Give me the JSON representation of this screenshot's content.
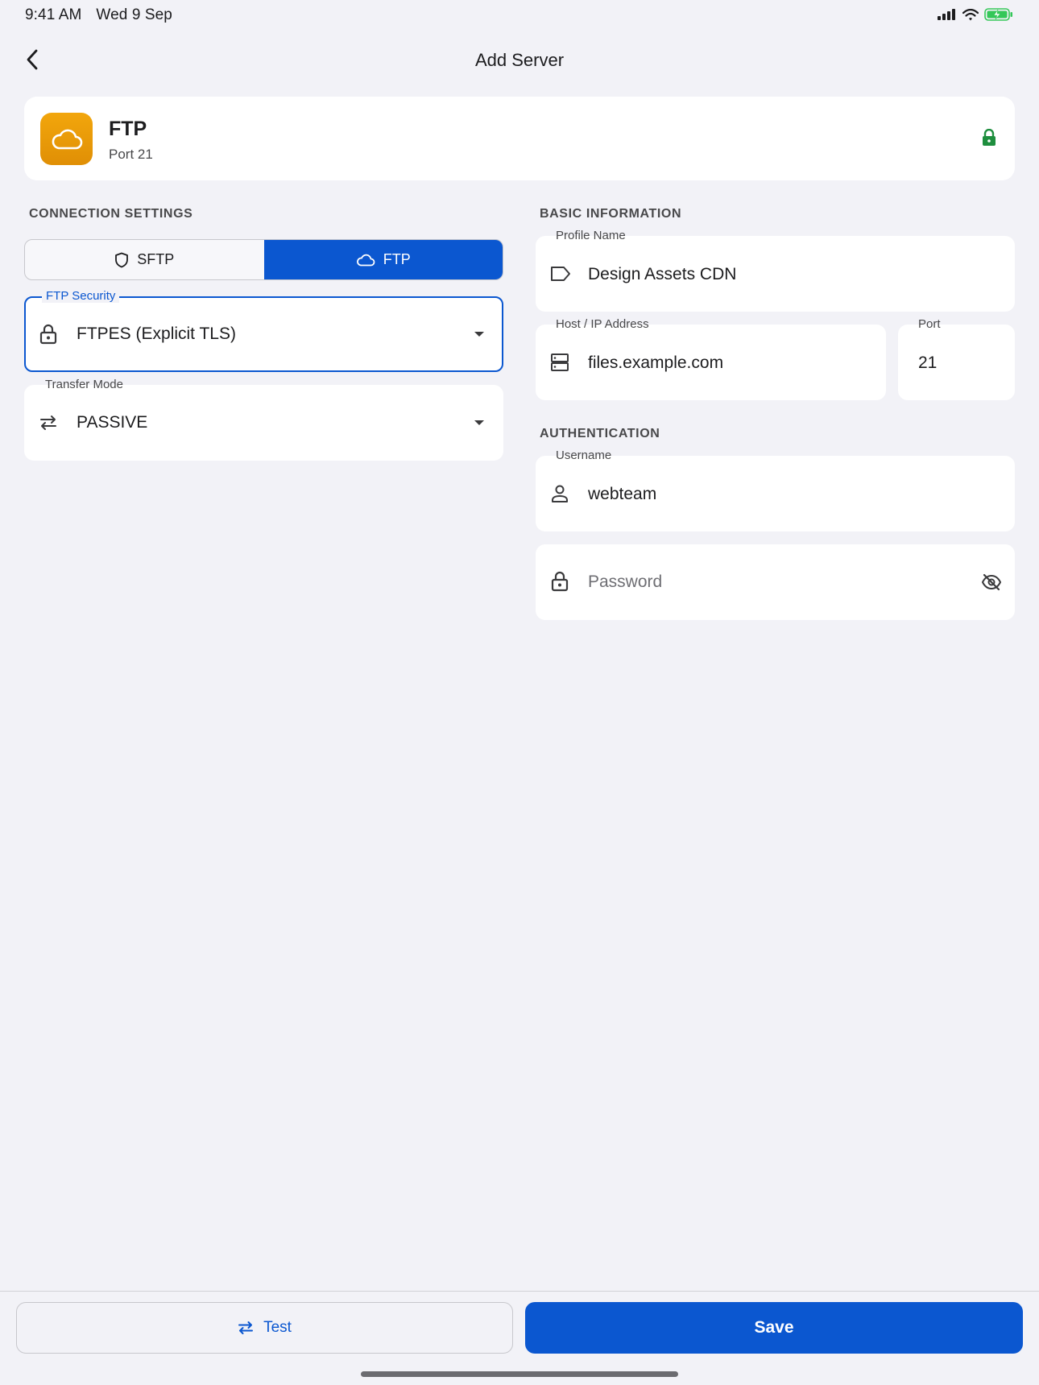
{
  "status": {
    "time": "9:41 AM",
    "date": "Wed 9 Sep"
  },
  "nav": {
    "title": "Add Server"
  },
  "header": {
    "title": "FTP",
    "subtitle": "Port 21"
  },
  "connection": {
    "section_label": "CONNECTION SETTINGS",
    "protocols": [
      {
        "label": "SFTP",
        "selected": false
      },
      {
        "label": "FTP",
        "selected": true
      }
    ],
    "security": {
      "label": "FTP Security",
      "value": "FTPES (Explicit TLS)"
    },
    "transfer": {
      "label": "Transfer Mode",
      "value": "PASSIVE"
    }
  },
  "basic": {
    "section_label": "BASIC INFORMATION",
    "profile": {
      "label": "Profile Name",
      "value": "Design Assets CDN"
    },
    "host": {
      "label": "Host / IP Address",
      "value": "files.example.com"
    },
    "port": {
      "label": "Port",
      "value": "21"
    }
  },
  "auth": {
    "section_label": "AUTHENTICATION",
    "username": {
      "label": "Username",
      "value": "webteam"
    },
    "password": {
      "placeholder": "Password"
    }
  },
  "actions": {
    "test_label": "Test",
    "save_label": "Save"
  },
  "colors": {
    "accent": "#0b57d0",
    "app_icon": "#f2a60c",
    "lock_green": "#1e8e3e",
    "battery_green": "#34c759"
  }
}
